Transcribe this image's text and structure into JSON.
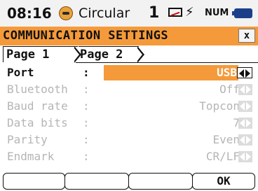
{
  "status": {
    "time": "08:16",
    "mode": "Circular",
    "indicator_number": "1",
    "numlock": "NUM",
    "icons": [
      "clock-icon",
      "envelope-icon",
      "usb-icon",
      "battery-icon"
    ]
  },
  "window": {
    "title": "COMMUNICATION SETTINGS",
    "close_label": "x"
  },
  "tabs": [
    {
      "label": "Page 1"
    },
    {
      "label": "Page 2"
    }
  ],
  "rows": [
    {
      "label": "Port",
      "colon": ":",
      "value": "USB"
    },
    {
      "label": "Bluetooth",
      "colon": ":",
      "value": "Off"
    },
    {
      "label": "Baud rate",
      "colon": ":",
      "value": "Topcon"
    },
    {
      "label": "Data bits",
      "colon": ":",
      "value": "7"
    },
    {
      "label": "Parity",
      "colon": ":",
      "value": "Even"
    },
    {
      "label": "Endmark",
      "colon": ":",
      "value": "CR/LF"
    }
  ],
  "softkeys": [
    "",
    "",
    "",
    "OK"
  ],
  "colors": {
    "accent": "#f59a3b",
    "disabled_text": "#b5b5b5"
  }
}
